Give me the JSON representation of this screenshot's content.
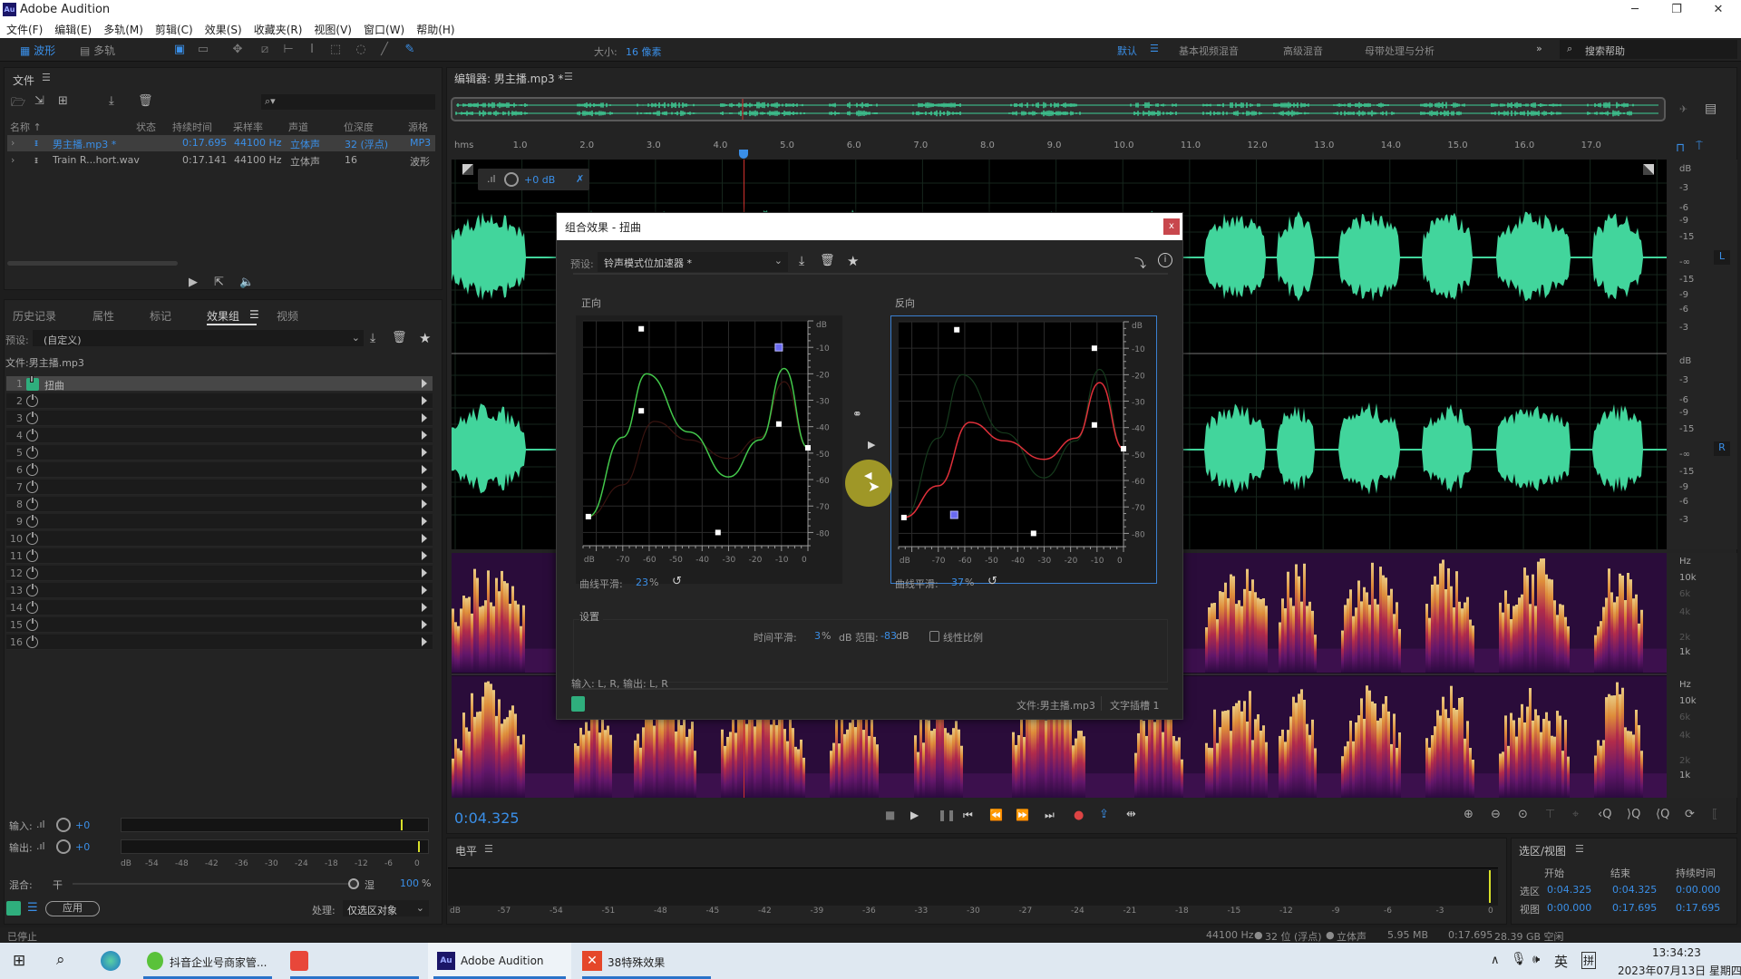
{
  "window": {
    "app_icon": "Au",
    "title": "Adobe Audition",
    "controls": [
      "minimize-icon",
      "restore-icon",
      "close-icon"
    ]
  },
  "menu": [
    "文件(F)",
    "编辑(E)",
    "多轨(M)",
    "剪辑(C)",
    "效果(S)",
    "收藏夹(R)",
    "视图(V)",
    "窗口(W)",
    "帮助(H)"
  ],
  "toolbar": {
    "waveform_label": "波形",
    "multitrack_label": "多轨",
    "size_label": "大小:",
    "size_value": "16 像素",
    "workspaces": [
      "默认",
      "基本视频混音",
      "高级混音",
      "母带处理与分析"
    ],
    "active_workspace": "默认",
    "more": "»",
    "search_placeholder": "搜索帮助"
  },
  "files_panel": {
    "title": "文件",
    "columns": [
      "名称 ↑",
      "状态",
      "持续时间",
      "采样率",
      "声道",
      "位深度",
      "源格式"
    ],
    "rows": [
      {
        "name": "男主播.mp3 *",
        "status": "",
        "duration": "0:17.695",
        "rate": "44100 Hz",
        "channels": "立体声",
        "depth": "32 (浮点)",
        "format": "MP3",
        "selected": true
      },
      {
        "name": "Train R...hort.wav",
        "status": "",
        "duration": "0:17.141",
        "rate": "44100 Hz",
        "channels": "立体声",
        "depth": "16",
        "format": "波形",
        "selected": false
      }
    ]
  },
  "lower_tabs": [
    "历史记录",
    "属性",
    "标记",
    "效果组",
    "视频"
  ],
  "active_lower_tab": "效果组",
  "effects_rack": {
    "preset_label": "预设:",
    "preset_value": "(自定义)",
    "file_label": "文件:男主播.mp3",
    "slots": [
      {
        "n": "1",
        "name": "扭曲",
        "on": true
      },
      {
        "n": "2",
        "name": ""
      },
      {
        "n": "3",
        "name": ""
      },
      {
        "n": "4",
        "name": ""
      },
      {
        "n": "5",
        "name": ""
      },
      {
        "n": "6",
        "name": ""
      },
      {
        "n": "7",
        "name": ""
      },
      {
        "n": "8",
        "name": ""
      },
      {
        "n": "9",
        "name": ""
      },
      {
        "n": "10",
        "name": ""
      },
      {
        "n": "11",
        "name": ""
      },
      {
        "n": "12",
        "name": ""
      },
      {
        "n": "13",
        "name": ""
      },
      {
        "n": "14",
        "name": ""
      },
      {
        "n": "15",
        "name": ""
      },
      {
        "n": "16",
        "name": ""
      }
    ],
    "input_label": "输入:",
    "input_value": "+0",
    "output_label": "输出:",
    "output_value": "+0",
    "meter_ticks": [
      "dB",
      "-54",
      "-48",
      "-42",
      "-36",
      "-30",
      "-24",
      "-18",
      "-12",
      "-6",
      "0"
    ],
    "input_peak_db": -4,
    "output_peak_db": -0.5,
    "mix_label": "混合:",
    "dry_label": "干",
    "wet_label": "湿",
    "mix_percent": 100,
    "mix_value": "100",
    "apply_label": "应用",
    "process_label": "处理:",
    "process_value": "仅选区对象"
  },
  "editor": {
    "title": "编辑器: 男主播.mp3 *",
    "ruler_unit": "hms",
    "ruler_ticks": [
      "1.0",
      "2.0",
      "3.0",
      "4.0",
      "5.0",
      "6.0",
      "7.0",
      "8.0",
      "9.0",
      "10.0",
      "11.0",
      "12.0",
      "13.0",
      "14.0",
      "15.0",
      "16.0",
      "17.0"
    ],
    "gain_value": "+0 dB",
    "db_scale": [
      "dB",
      "-3",
      "-6",
      "-9",
      "-15",
      "-∞",
      "-15",
      "-9",
      "-6",
      "-3"
    ],
    "channels": [
      "L",
      "R"
    ],
    "hz_scale": [
      "Hz",
      "10k",
      "6k",
      "4k",
      "2k",
      "1k"
    ],
    "playhead_time": "0:04.325",
    "playhead_seconds": 4.325,
    "duration_seconds": 17.695
  },
  "dialog": {
    "title": "组合效果 - 扭曲",
    "preset_label": "预设:",
    "preset_value": "铃声模式位加速器 *",
    "positive_label": "正向",
    "negative_label": "反向",
    "smooth_label": "曲线平滑:",
    "positive_smooth": "23",
    "negative_smooth": "37",
    "percent": "%",
    "settings_label": "设置",
    "time_smooth_label": "时间平滑:",
    "time_smooth_value": "3",
    "db_range_label": "dB 范围:",
    "db_range_value": "-83",
    "db_unit": "dB",
    "linear_label": "线性比例",
    "io_label": "输入: L, R, 输出: L, R",
    "file_label": "文件:男主播.mp3",
    "insert_label": "文字插槽 1",
    "graph_x_ticks": [
      "dB",
      "-70",
      "-60",
      "-50",
      "-40",
      "-30",
      "-20",
      "-10",
      "0"
    ],
    "graph_y_ticks": [
      "dB",
      "-10",
      "-20",
      "-30",
      "-40",
      "-50",
      "-60",
      "-70",
      "-80"
    ],
    "positive_points": [
      [
        -83,
        -74
      ],
      [
        -63,
        -3
      ],
      [
        -63,
        -34
      ],
      [
        -34,
        -80
      ],
      [
        -11,
        -10
      ],
      [
        -11,
        -39
      ],
      [
        0,
        -48
      ]
    ],
    "negative_points": [
      [
        -83,
        -74
      ],
      [
        -63,
        -3
      ],
      [
        -64,
        -73
      ],
      [
        -34,
        -80
      ],
      [
        -11,
        -10
      ],
      [
        -11,
        -39
      ],
      [
        0,
        -48
      ]
    ]
  },
  "transport": {
    "time": "0:04.325"
  },
  "levels_panel": {
    "title": "电平",
    "ticks": [
      "dB",
      "-57",
      "-54",
      "-51",
      "-48",
      "-45",
      "-42",
      "-39",
      "-36",
      "-33",
      "-30",
      "-27",
      "-24",
      "-21",
      "-18",
      "-15",
      "-12",
      "-9",
      "-6",
      "-3",
      "0"
    ]
  },
  "selection_panel": {
    "title": "选区/视图",
    "headers": [
      "开始",
      "结束",
      "持续时间"
    ],
    "rows": [
      {
        "label": "选区",
        "start": "0:04.325",
        "end": "0:04.325",
        "duration": "0:00.000"
      },
      {
        "label": "视图",
        "start": "0:00.000",
        "end": "0:17.695",
        "duration": "0:17.695"
      }
    ]
  },
  "status_bar": {
    "left": "已停止",
    "rate": "44100 Hz",
    "depth": "32 位 (浮点)",
    "channels": "立体声",
    "size": "5.95 MB",
    "duration": "0:17.695",
    "free": "28.39 GB 空闲"
  },
  "taskbar": {
    "apps": [
      {
        "label": "抖音企业号商家管...",
        "icon": "browser-icon"
      },
      {
        "label": "",
        "icon": "camtasia-icon"
      },
      {
        "label": "Adobe Audition",
        "icon": "audition-icon",
        "active": true
      },
      {
        "label": "38特殊效果",
        "icon": "x-app-icon"
      }
    ],
    "ime_lang": "英",
    "ime_mode": "拼",
    "time": "13:34:23",
    "date": "2023年07月13日 星期四"
  }
}
